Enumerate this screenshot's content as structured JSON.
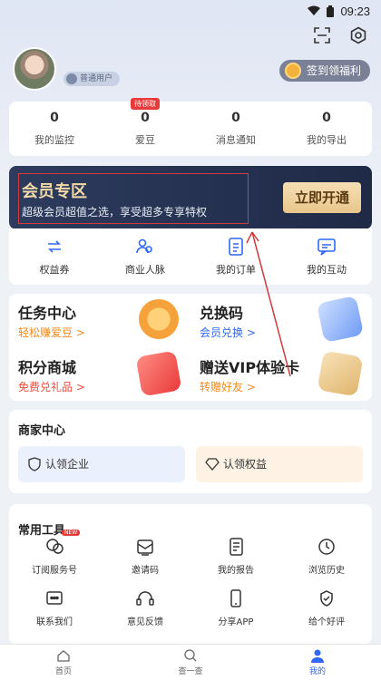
{
  "status": {
    "time": "09:23"
  },
  "user": {
    "badge": "普通用户"
  },
  "signin": {
    "label": "签到领福利"
  },
  "stats": [
    {
      "num": "0",
      "label": "我的监控"
    },
    {
      "num": "0",
      "label": "爱豆",
      "tag": "待领取"
    },
    {
      "num": "0",
      "label": "消息通知"
    },
    {
      "num": "0",
      "label": "我的导出"
    }
  ],
  "vip": {
    "title": "会员专区",
    "subtitle": "超级会员超值之选，享受超多专享特权",
    "button": "立即开通"
  },
  "shortcuts": [
    {
      "label": "权益券",
      "icon": "ticket-icon"
    },
    {
      "label": "商业人脉",
      "icon": "people-icon"
    },
    {
      "label": "我的订单",
      "icon": "order-icon"
    },
    {
      "label": "我的互动",
      "icon": "chat-icon"
    }
  ],
  "tasks": [
    {
      "title": "任务中心",
      "sub": "轻松赚爱豆 >",
      "subColor": "#f08a1c"
    },
    {
      "title": "兑换码",
      "sub": "会员兑换 >",
      "subColor": "#2f67f6"
    },
    {
      "title": "积分商城",
      "sub": "免费兑礼品 >",
      "subColor": "#f04a3a"
    },
    {
      "title": "赠送VIP体验卡",
      "sub": "转赠好友 >",
      "subColor": "#f08a1c"
    }
  ],
  "merchant": {
    "title": "商家中心",
    "claim_company": "认领企业",
    "claim_rights": "认领权益"
  },
  "tools": {
    "title": "常用工具",
    "items": [
      {
        "label": "订阅服务号",
        "icon": "subscribe-icon",
        "tag": "NEW"
      },
      {
        "label": "邀请码",
        "icon": "invite-icon"
      },
      {
        "label": "我的报告",
        "icon": "report-icon"
      },
      {
        "label": "浏览历史",
        "icon": "history-icon"
      },
      {
        "label": "联系我们",
        "icon": "contact-icon"
      },
      {
        "label": "意见反馈",
        "icon": "feedback-icon"
      },
      {
        "label": "分享APP",
        "icon": "share-icon"
      },
      {
        "label": "给个好评",
        "icon": "rate-icon"
      }
    ]
  },
  "tabs": [
    {
      "label": "首页",
      "icon": "home-icon"
    },
    {
      "label": "查一查",
      "icon": "search-icon"
    },
    {
      "label": "我的",
      "icon": "user-icon",
      "active": true
    }
  ],
  "colors": {
    "accent": "#2f67f6",
    "vip_bg": "#1f2a46",
    "vip_gold": "#f1d9a8",
    "annotation_red": "#d23b3b"
  }
}
